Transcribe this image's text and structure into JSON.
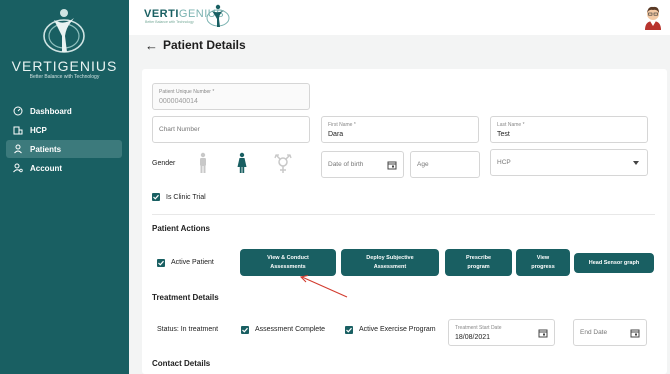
{
  "brand": {
    "name": "VERTIGENIUS",
    "tagline": "Better Balance with Technology",
    "top_name_part1": "VERTI",
    "top_name_part2": "GENIUS",
    "top_tagline": "Better Balance with Technology"
  },
  "sidebar": {
    "items": [
      {
        "label": "Dashboard",
        "icon": "dashboard-icon"
      },
      {
        "label": "HCP",
        "icon": "building-icon"
      },
      {
        "label": "Patients",
        "icon": "person-icon",
        "active": true
      },
      {
        "label": "Account",
        "icon": "account-icon"
      }
    ]
  },
  "page": {
    "back": "←",
    "title": "Patient Details"
  },
  "form": {
    "patient_number_label": "Patient Unique Number *",
    "patient_number_value": "0000040014",
    "chart_number_placeholder": "Chart Number",
    "first_name_label": "First Name *",
    "first_name_value": "Dara",
    "last_name_label": "Last Name *",
    "last_name_value": "Test",
    "gender_label": "Gender",
    "dob_placeholder": "Date of birth",
    "age_placeholder": "Age",
    "hcp_placeholder": "HCP",
    "clinic_trial_label": "Is Clinic Trial"
  },
  "actions": {
    "section_title": "Patient Actions",
    "active_patient_label": "Active Patient",
    "buttons": [
      "View & Conduct\nAssessments",
      "Deploy Subjective\nAssessment",
      "Prescribe\nprogram",
      "View\nprogress",
      "Head Sensor graph"
    ]
  },
  "treatment": {
    "section_title": "Treatment Details",
    "status": "Status: In treatment",
    "assessment_complete": "Assessment Complete",
    "active_exercise": "Active Exercise Program",
    "start_date_label": "Treatment Start Date",
    "start_date_value": "18/08/2021",
    "end_date_placeholder": "End Date"
  },
  "contact": {
    "section_title": "Contact Details"
  },
  "colors": {
    "sidebar": "#195f62",
    "accent": "#195f62",
    "annotation": "#d23b2e"
  }
}
